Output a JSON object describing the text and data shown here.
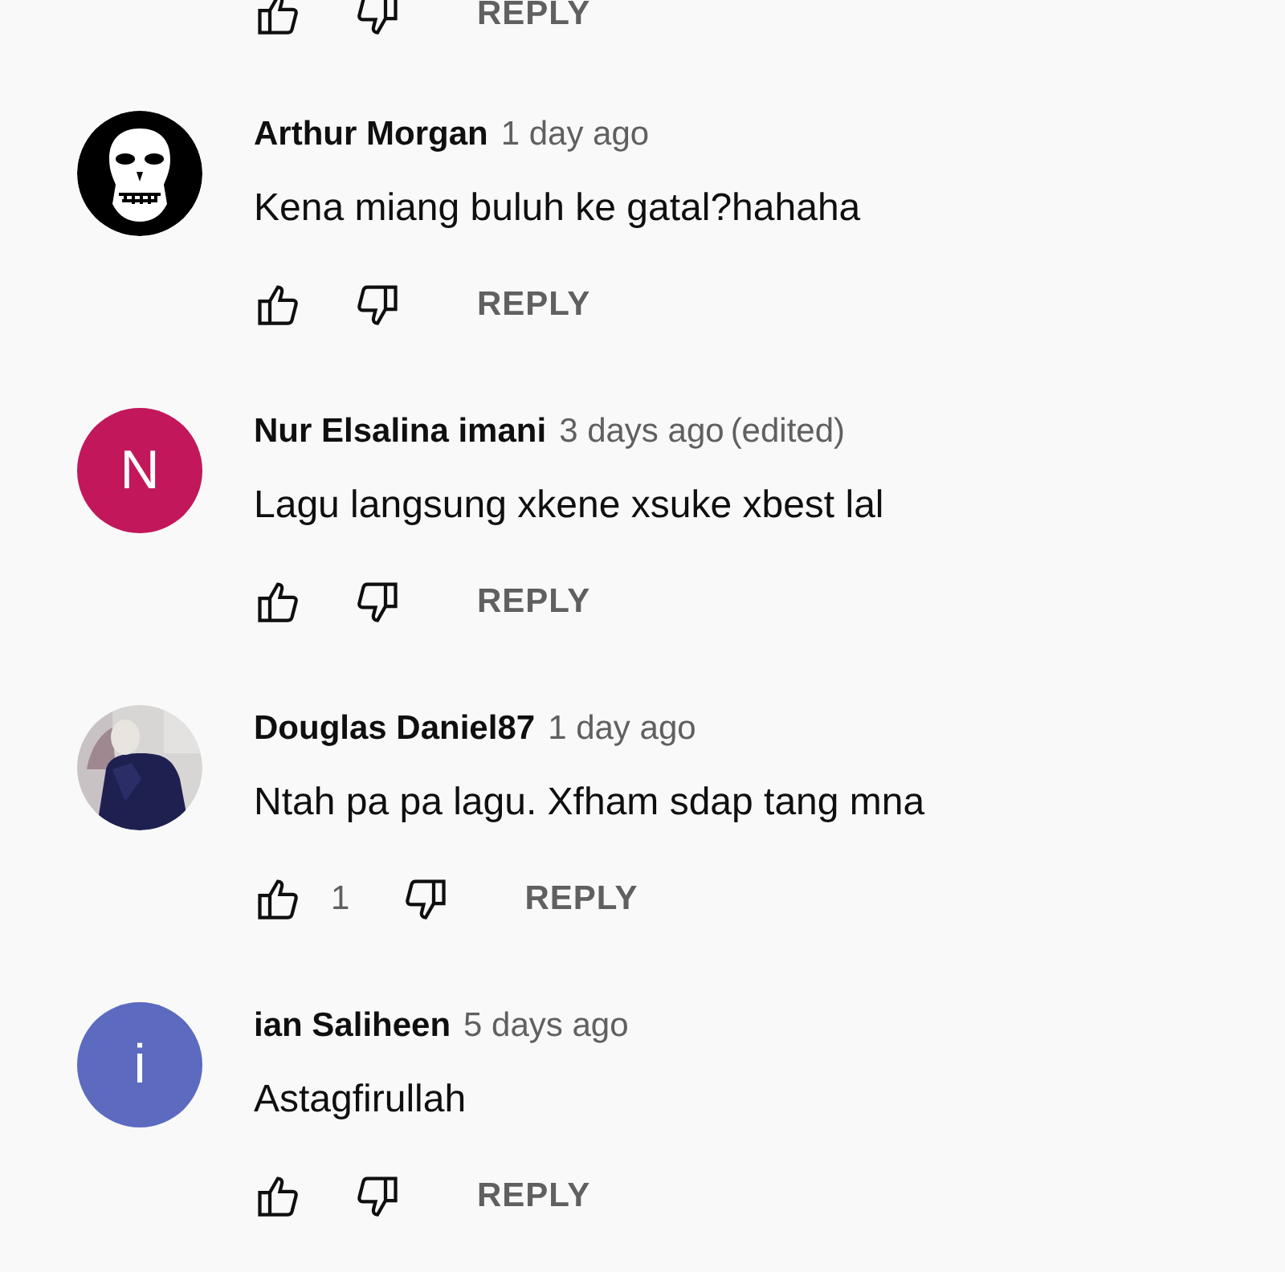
{
  "top_actions": {
    "reply": "REPLY"
  },
  "comments": [
    {
      "author": "Arthur Morgan",
      "time": "1 day ago",
      "text": "Kena miang buluh ke gatal?hahaha",
      "avatar": {
        "kind": "skull"
      },
      "reply": "REPLY"
    },
    {
      "author": "Nur Elsalina imani",
      "time": "3 days ago",
      "edited": "(edited)",
      "text": "Lagu langsung xkene xsuke xbest lal",
      "avatar": {
        "kind": "letter",
        "letter": "N",
        "color": "#c2185b"
      },
      "reply": "REPLY"
    },
    {
      "author": "Douglas Daniel87",
      "time": "1 day ago",
      "text": "Ntah pa pa lagu. Xfham sdap tang mna",
      "likes": "1",
      "reply": "REPLY"
    },
    {
      "author": "ian Saliheen",
      "time": "5 days ago",
      "text": "Astagfirullah",
      "avatar": {
        "kind": "letter",
        "letter": "i",
        "color": "#5c6bc0"
      },
      "reply": "REPLY"
    }
  ]
}
